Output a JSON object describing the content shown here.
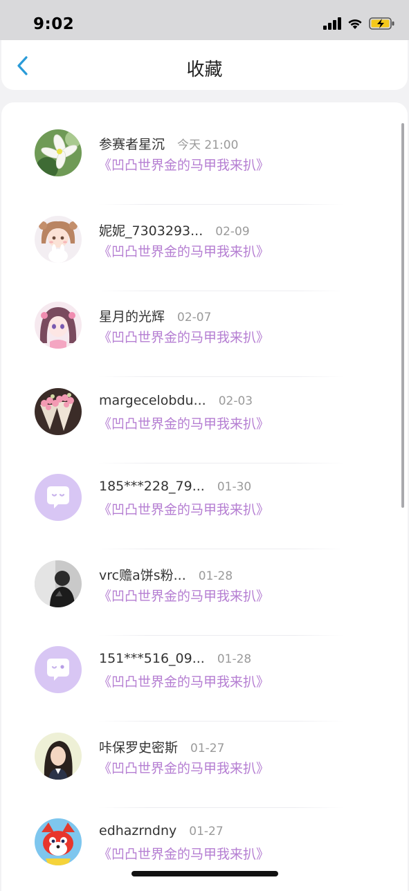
{
  "status_bar": {
    "time": "9:02"
  },
  "header": {
    "title": "收藏",
    "back_icon": "chevron-left-icon"
  },
  "colors": {
    "accent": "#2a9bd8",
    "subtitle": "#b57ed2",
    "default_avatar_bg": "#d8c6f4"
  },
  "favorites": [
    {
      "name": "参赛者星沉",
      "time": "今天 21:00",
      "subtitle": "《凹凸世界金的马甲我来扒》",
      "avatar": "lily-flower-avatar"
    },
    {
      "name": "妮妮_7303293...",
      "time": "02-09",
      "subtitle": "《凹凸世界金的马甲我来扒》",
      "avatar": "anime-girl-bunny-avatar"
    },
    {
      "name": "星月的光辉",
      "time": "02-07",
      "subtitle": "《凹凸世界金的马甲我来扒》",
      "avatar": "anime-girl-pink-avatar"
    },
    {
      "name": "margecelobdu...",
      "time": "02-03",
      "subtitle": "《凹凸世界金的马甲我来扒》",
      "avatar": "pink-bouquets-avatar"
    },
    {
      "name": "185***228_79...",
      "time": "01-30",
      "subtitle": "《凹凸世界金的马甲我来扒》",
      "avatar": "default-chat-avatar"
    },
    {
      "name": "vrc赡a饼s粉...",
      "time": "01-28",
      "subtitle": "《凹凸世界金的马甲我来扒》",
      "avatar": "dark-photo-avatar"
    },
    {
      "name": "151***516_09...",
      "time": "01-28",
      "subtitle": "《凹凸世界金的马甲我来扒》",
      "avatar": "default-chat-avatar"
    },
    {
      "name": "咔保罗史密斯",
      "time": "01-27",
      "subtitle": "《凹凸世界金的马甲我来扒》",
      "avatar": "girl-portrait-avatar"
    },
    {
      "name": "edhazrndny",
      "time": "01-27",
      "subtitle": "《凹凸世界金的马甲我来扒》",
      "avatar": "red-cartoon-fox-avatar"
    }
  ]
}
